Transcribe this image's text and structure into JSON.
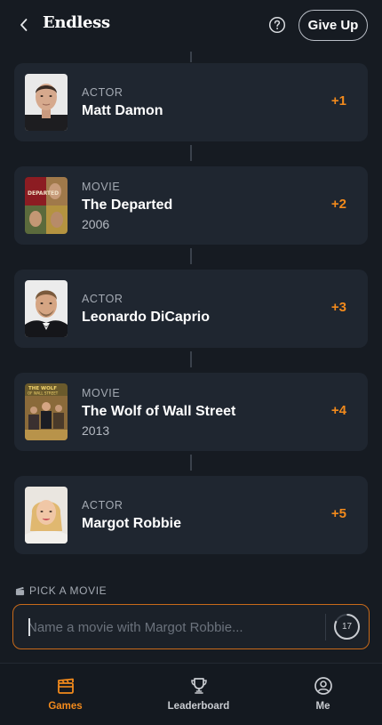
{
  "header": {
    "title": "Endless",
    "give_up_label": "Give Up"
  },
  "chain": [
    {
      "kind": "ACTOR",
      "name": "Matt Damon",
      "year": "",
      "points": "+1",
      "thumb": "actor-portrait"
    },
    {
      "kind": "MOVIE",
      "name": "The Departed",
      "year": "2006",
      "points": "+2",
      "thumb": "movie-poster"
    },
    {
      "kind": "ACTOR",
      "name": "Leonardo DiCaprio",
      "year": "",
      "points": "+3",
      "thumb": "actor-portrait"
    },
    {
      "kind": "MOVIE",
      "name": "The Wolf of Wall Street",
      "year": "2013",
      "points": "+4",
      "thumb": "movie-poster"
    },
    {
      "kind": "ACTOR",
      "name": "Margot Robbie",
      "year": "",
      "points": "+5",
      "thumb": "actor-portrait"
    }
  ],
  "pick": {
    "label": "PICK A MOVIE",
    "icon": "clapperboard-icon",
    "placeholder": "Name a movie with Margot Robbie...",
    "value": "",
    "timer_seconds": "17"
  },
  "nav": {
    "items": [
      {
        "label": "Games",
        "icon": "clapperboard-icon",
        "active": true
      },
      {
        "label": "Leaderboard",
        "icon": "trophy-icon",
        "active": false
      },
      {
        "label": "Me",
        "icon": "user-icon",
        "active": false
      }
    ]
  },
  "colors": {
    "background": "#161b22",
    "card": "#1f2630",
    "accent": "#f28a1c",
    "muted_text": "#a4aab3",
    "input_border": "#c86a1a"
  }
}
